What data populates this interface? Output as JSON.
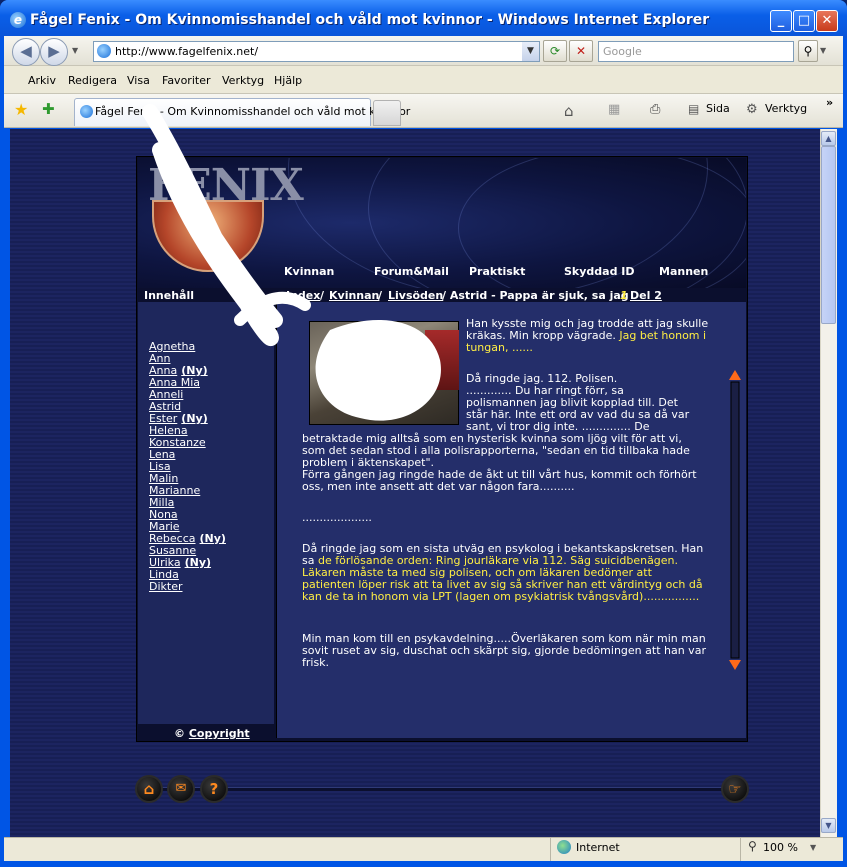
{
  "window": {
    "title": "Fågel Fenix - Om Kvinnomisshandel och våld mot kvinnor - Windows Internet Explorer",
    "btn_min": "_",
    "btn_max": "□",
    "btn_close": "✕"
  },
  "address": {
    "url": "http://www.fagelfenix.net/",
    "search_placeholder": "Google"
  },
  "menu": [
    "Arkiv",
    "Redigera",
    "Visa",
    "Favoriter",
    "Verktyg",
    "Hjälp"
  ],
  "tab": {
    "label": "Fågel Fenix - Om Kvinnomisshandel och våld mot kvinnor"
  },
  "toolbar": {
    "page_label": "Sida",
    "tools_label": "Verktyg"
  },
  "site": {
    "logo_text": "FENIX",
    "nav": [
      "Kvinnan",
      "Forum&Mail",
      "Praktiskt",
      "Skyddad ID",
      "Mannen"
    ],
    "innehall": "Innehåll",
    "breadcrumb": {
      "index": "Index",
      "sep1": "/",
      "kvinnan": "Kvinnan",
      "sep2": "/",
      "livsoden": "Livsöden",
      "rest": "/ Astrid - Pappa är sjuk, sa jag",
      "num": "1",
      "del2": "Del 2"
    },
    "names": [
      {
        "name": "Agnetha",
        "ny": ""
      },
      {
        "name": "Ann",
        "ny": ""
      },
      {
        "name": "Anna",
        "ny": "(Ny)"
      },
      {
        "name": "Anna Mia",
        "ny": ""
      },
      {
        "name": "Anneli",
        "ny": ""
      },
      {
        "name": "Astrid",
        "ny": ""
      },
      {
        "name": "Ester",
        "ny": "(Ny)"
      },
      {
        "name": "Helena",
        "ny": ""
      },
      {
        "name": "Konstanze",
        "ny": ""
      },
      {
        "name": "Lena",
        "ny": ""
      },
      {
        "name": "Lisa",
        "ny": ""
      },
      {
        "name": "Malin",
        "ny": ""
      },
      {
        "name": "Marianne",
        "ny": ""
      },
      {
        "name": "Milla",
        "ny": ""
      },
      {
        "name": "Nona",
        "ny": ""
      },
      {
        "name": "Marie",
        "ny": ""
      },
      {
        "name": "Rebecca",
        "ny": "(Ny)"
      },
      {
        "name": "Susanne",
        "ny": ""
      },
      {
        "name": "Ulrika",
        "ny": "(Ny)"
      },
      {
        "name": "Linda",
        "ny": ""
      },
      {
        "name": "Dikter",
        "ny": ""
      }
    ],
    "copyright_symbol": "©",
    "copyright_link": "Copyright",
    "p1_white": "Han kysste mig och jag trodde att jag skulle kräkas. Min kropp vägrade.",
    "p1_yellow": "Jag bet honom i tungan, ......",
    "p2_l1": "Då ringde jag. 112. Polisen.",
    "p2_l2": "............. Du har ringt förr, sa",
    "p2_l3": "polismannen jag blivit kopplad till. Det",
    "p2_l4": "står här. Inte ett ord av vad du sa då var",
    "p2_l5": "sant, vi tror dig inte. .............. De",
    "p2_rest": "betraktade mig alltså som en hysterisk kvinna som ljög vilt för att vi, som det sedan stod i alla polisrapporterna, \"sedan en tid tillbaka hade problem i äktenskapet\".",
    "p3": "Förra gången jag ringde hade de åkt ut till vårt hus, kommit och förhört oss, men inte ansett att det var någon fara..........",
    "dots": "....................",
    "p4_white": "Då ringde jag som en sista utväg en psykolog i bekantskapskretsen.",
    "p4_mix_white": "Han sa",
    "p4_yellow": "de förlösande orden: Ring jourläkare via 112. Säg suicidbenägen. Läkaren måste ta med sig polisen, och om läkaren bedömer att patienten löper risk att ta livet av sig så skriver han ett vårdintyg och då kan de ta in honom via LPT (lagen om psykiatrisk tvångsvård)................",
    "p5": "Min man kom till en psykavdelning.....Överläkaren som kom när min man sovit ruset av sig, duschat och skärpt sig, gjorde bedömingen att han var frisk."
  },
  "status": {
    "zone": "Internet",
    "zoom": "100 %"
  }
}
